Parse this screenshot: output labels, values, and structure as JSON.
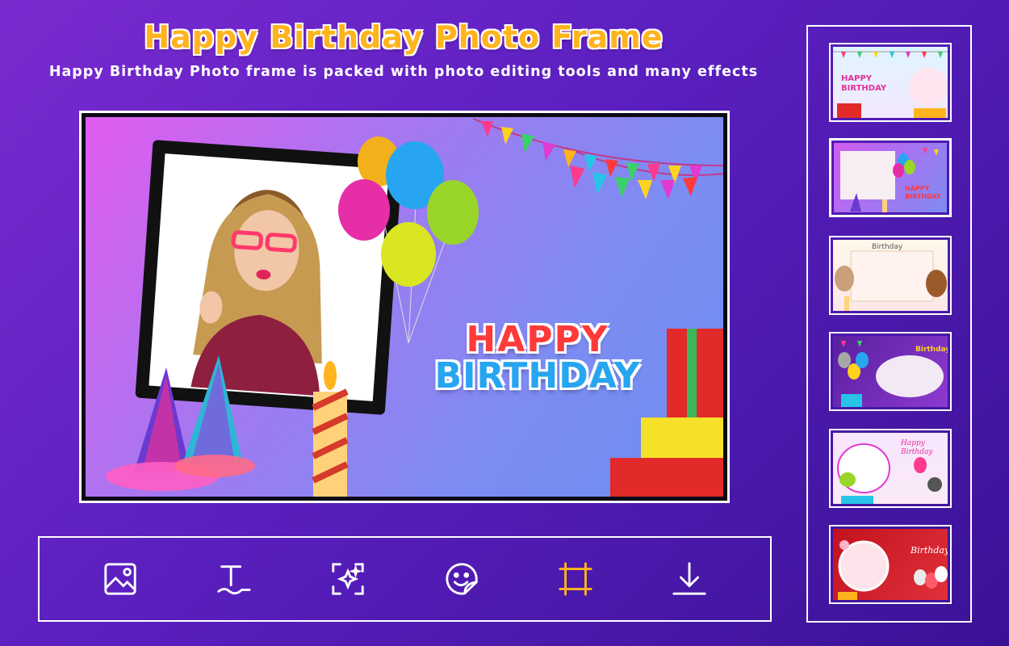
{
  "header": {
    "title": "Happy Birthday Photo Frame",
    "subtitle": "Happy Birthday Photo frame is packed with photo editing tools and many effects"
  },
  "canvas": {
    "greeting_line1": "HAPPY",
    "greeting_line2": "BIRTHDAY"
  },
  "toolbar": {
    "tools": [
      {
        "name": "gallery-icon",
        "active": false
      },
      {
        "name": "text-icon",
        "active": false
      },
      {
        "name": "effects-icon",
        "active": false
      },
      {
        "name": "sticker-icon",
        "active": false
      },
      {
        "name": "frame-icon",
        "active": true
      },
      {
        "name": "download-icon",
        "active": false
      }
    ]
  },
  "thumbnails": {
    "items": [
      {
        "label": "HAPPY BIRTHDAY",
        "selected": false
      },
      {
        "label": "HAPPY BIRTHDAY",
        "selected": true
      },
      {
        "label": "Birthday",
        "selected": false
      },
      {
        "label": "Birthday",
        "selected": false
      },
      {
        "label": "Happy Birthday",
        "selected": false
      },
      {
        "label": "Birthday",
        "selected": false
      }
    ]
  },
  "colors": {
    "accent": "#ffb41e",
    "icon": "#ffffff",
    "active_icon": "#ffb41e",
    "background": "#5a1fbf"
  }
}
